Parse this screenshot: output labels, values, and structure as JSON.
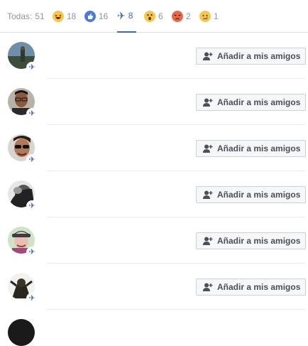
{
  "tabs": [
    {
      "id": "all",
      "label": "Todas:",
      "count": "51"
    },
    {
      "id": "haha",
      "icon": "haha-emoji-icon",
      "count": "18"
    },
    {
      "id": "like",
      "icon": "like-thumb-icon",
      "count": "16"
    },
    {
      "id": "plane",
      "icon": "airplane-icon",
      "count": "8",
      "active": true
    },
    {
      "id": "wow",
      "icon": "wow-emoji-icon",
      "count": "6"
    },
    {
      "id": "angry",
      "icon": "angry-emoji-icon",
      "count": "2"
    },
    {
      "id": "sad",
      "icon": "sad-emoji-icon",
      "count": "1"
    }
  ],
  "people": [
    {
      "avatar": "person-outdoors-avatar",
      "button_label": "Añadir a mis amigos"
    },
    {
      "avatar": "person-glasses-avatar",
      "button_label": "Añadir a mis amigos"
    },
    {
      "avatar": "person-sunglasses-avatar",
      "button_label": "Añadir a mis amigos"
    },
    {
      "avatar": "person-bw-avatar",
      "button_label": "Añadir a mis amigos"
    },
    {
      "avatar": "person-cap-avatar",
      "button_label": "Añadir a mis amigos"
    },
    {
      "avatar": "person-statue-avatar",
      "button_label": "Añadir a mis amigos"
    }
  ],
  "colors": {
    "accent": "#4267b2",
    "muted": "#90949c",
    "button_bg": "#f6f7f9"
  }
}
